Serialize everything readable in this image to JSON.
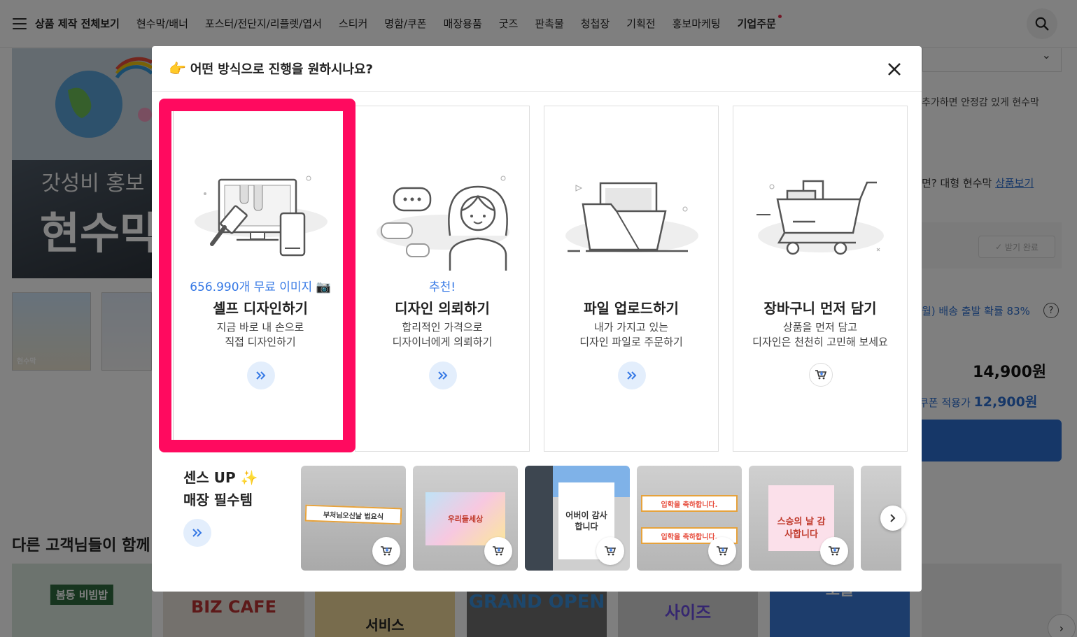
{
  "nav": {
    "all_products": "상품 제작 전체보기",
    "items": [
      "현수막/배너",
      "포스터/전단지/리플렛/엽서",
      "스티커",
      "명함/쿠폰",
      "매장용품",
      "굿즈",
      "판촉물",
      "청첩장",
      "기획전",
      "홍보마케팅"
    ],
    "corporate": "기업주문"
  },
  "background": {
    "hero_sub": "갓성비 홍보",
    "hero_title": "현수막",
    "thumb_caption": "현수막",
    "side_text": "추가하면 안정감 있게 현수막",
    "large_banner_prefix": "면? 대형 현수막 ",
    "large_banner_link": "상품보기",
    "coupon_received": "받기 완료",
    "shipping": "월) 배송 출발 확률 83%",
    "help": "?",
    "price": "14,900원",
    "coupon_price_prefix": "쿠폰 적용가 ",
    "coupon_price": "12,900원",
    "section_title": "다른 고객님들이 함께",
    "card_texts": [
      "봄동 비빔밥",
      "BIZ CAFE",
      "서비스",
      "GRAND OPEN",
      "사이즈",
      "오늘"
    ]
  },
  "modal": {
    "hand_emoji": "👉",
    "title": "어떤 방식으로 진행을 원하시나요?",
    "options": [
      {
        "tag": "656.990개 무료 이미지 📷",
        "title": "셀프 디자인하기",
        "desc1": "지금 바로 내 손으로",
        "desc2": "직접 디자인하기",
        "icon": "double-chevron-icon"
      },
      {
        "tag": "추천!",
        "title": "디자인 의뢰하기",
        "desc1": "합리적인 가격으로",
        "desc2": "디자이너에게 의뢰하기",
        "icon": "double-chevron-icon"
      },
      {
        "tag": "",
        "title": "파일 업로드하기",
        "desc1": "내가 가지고 있는",
        "desc2": "디자인 파일로 주문하기",
        "icon": "double-chevron-icon"
      },
      {
        "tag": "",
        "title": "장바구니 먼저 담기",
        "desc1": "상품을 먼저 담고",
        "desc2": "디자인은 천천히 고민해 보세요",
        "icon": "cart-icon"
      }
    ],
    "sense_line1": "센스 UP ✨",
    "sense_line2": "매장 필수템",
    "products": [
      {
        "text": "부처님오신날 법요식"
      },
      {
        "text": "우리들세상"
      },
      {
        "text": "어버이 감사 합니다"
      },
      {
        "text": "입학을 축하합니다."
      },
      {
        "text": "스승의 날 감사합니다"
      }
    ]
  },
  "colors": {
    "accent": "#3578e5",
    "highlight": "#ff0a5f",
    "buy_button": "#2c6fd1"
  }
}
